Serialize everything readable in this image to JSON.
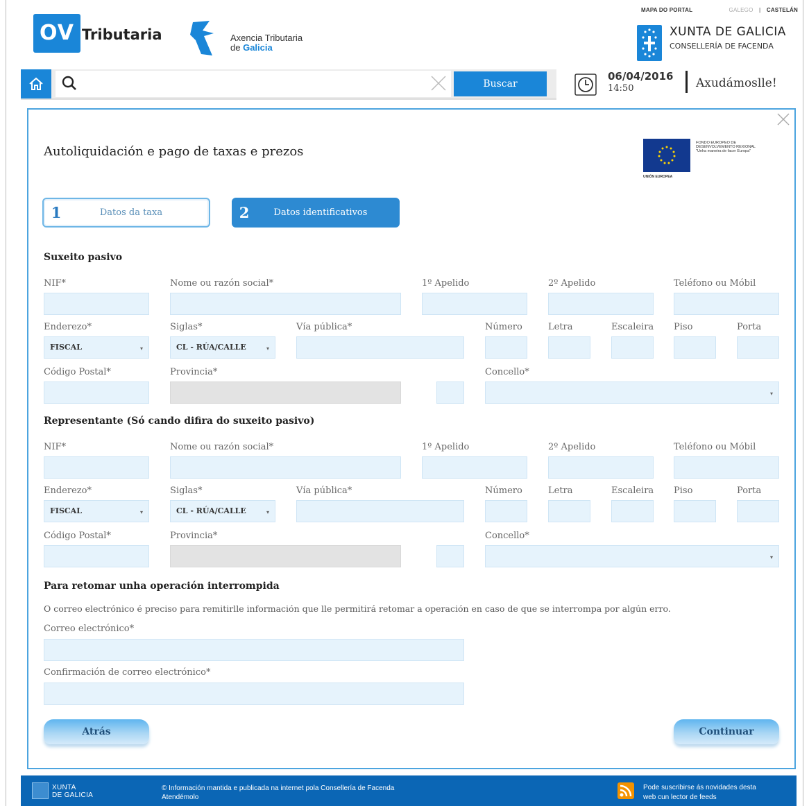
{
  "header": {
    "topnav": {
      "portal_map": "MAPA DO PORTAL",
      "lang_galego": "GALEGO",
      "separator": "|",
      "lang_castelan": "CASTELÁN"
    },
    "ov_logo": "OV",
    "ov_label": "Tributaria",
    "atg_line1": "Axencia Tributaria",
    "atg_line2_prefix": "de ",
    "atg_line2_accent": "Galicia",
    "xunta_line1": "XUNTA DE GALICIA",
    "xunta_line2": "CONSELLERÍA DE FACENDA"
  },
  "search": {
    "placeholder": "",
    "button_label": "Buscar"
  },
  "status": {
    "date": "06/04/2016",
    "time": "14:50",
    "help_label": "Axudámoslle!"
  },
  "form": {
    "title": "Autoliquidación e pago de taxas e prezos",
    "eu_text": "FONDO EUROPEO DE DESENVOLVEMENTO REXIONAL \"Unha maneira de facer Europa\"",
    "eu_label": "UNIÓN EUROPEA",
    "steps": [
      {
        "num": "1",
        "label": "Datos da taxa"
      },
      {
        "num": "2",
        "label": "Datos identificativos"
      }
    ],
    "taxpayer": {
      "heading": "Suxeito pasivo",
      "nif": "NIF*",
      "name": "Nome ou razón social*",
      "surname1": "1º Apelido",
      "surname2": "2º Apelido",
      "phone": "Teléfono ou Móbil",
      "address_type": "Enderezo*",
      "address_value": "FISCAL",
      "abbrev": "Siglas*",
      "abbrev_value": "CL - RÚA/CALLE",
      "street": "Vía pública*",
      "number": "Número",
      "letter": "Letra",
      "stair": "Escaleira",
      "floor": "Piso",
      "door": "Porta",
      "postcode": "Código Postal*",
      "province": "Provincia*",
      "council": "Concello*"
    },
    "representative": {
      "heading": "Representante (Só cando difira do suxeito pasivo)",
      "nif": "NIF*",
      "name": "Nome ou razón social*",
      "surname1": "1º Apelido",
      "surname2": "2º Apelido",
      "phone": "Teléfono ou Móbil",
      "address_type": "Enderezo*",
      "address_value": "FISCAL",
      "abbrev": "Siglas*",
      "abbrev_value": "CL - RÚA/CALLE",
      "street": "Vía pública*",
      "number": "Número",
      "letter": "Letra",
      "stair": "Escaleira",
      "floor": "Piso",
      "door": "Porta",
      "postcode": "Código Postal*",
      "province": "Provincia*",
      "council": "Concello*"
    },
    "resume": {
      "heading": "Para retomar unha operación interrompida",
      "note": "O correo electrónico é preciso para remitirlle información que lle permitirá retomar a operación en caso de que se interrompa por algún erro.",
      "email": "Correo electrónico*",
      "email_confirm": "Confirmación de correo electrónico*"
    },
    "back_button": "Atrás",
    "continue_button": "Continuar"
  },
  "footer": {
    "logo_line1": "XUNTA",
    "logo_line2": "DE GALICIA",
    "info_line1": "© Información mantida e publicada na internet pola Consellería de Facenda",
    "info_line2": "Atendémolo",
    "rss_line1": "Pode suscribirse ás novidades desta",
    "rss_line2": "web cun lector de feeds"
  },
  "colors": {
    "brand_blue": "#1a86d8",
    "panel_border": "#4ca4df",
    "footer_blue": "#0b66b5",
    "input_bg": "#e6f3fc"
  },
  "icons": [
    "home-icon",
    "search-icon",
    "clear-icon",
    "clock-icon",
    "close-icon",
    "select-caret-icon",
    "rss-icon",
    "xunta-logo-icon",
    "eu-flag-icon"
  ]
}
